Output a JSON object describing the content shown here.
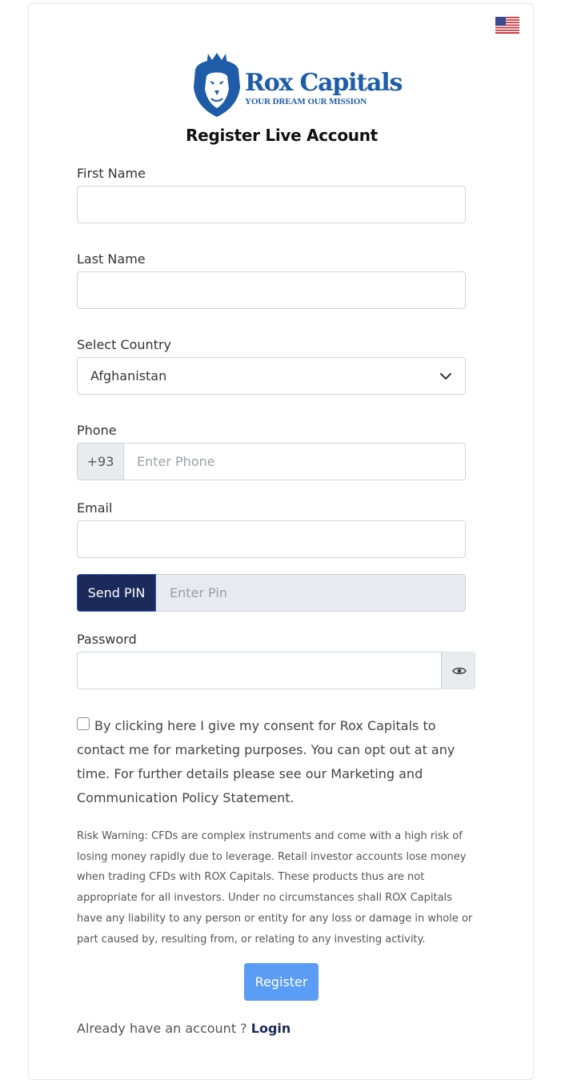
{
  "header": {
    "language_flag": "us-flag-icon",
    "brand_name": "Rox Capitals",
    "brand_tagline": "YOUR DREAM OUR MISSION",
    "title": "Register Live Account"
  },
  "form": {
    "first_name_label": "First Name",
    "first_name_value": "",
    "last_name_label": "Last Name",
    "last_name_value": "",
    "country_label": "Select Country",
    "country_selected": "Afghanistan",
    "phone_label": "Phone",
    "phone_prefix": "+93",
    "phone_placeholder": "Enter Phone",
    "email_label": "Email",
    "email_value": "",
    "send_pin_label": "Send PIN",
    "pin_placeholder": "Enter Pin",
    "password_label": "Password",
    "password_value": ""
  },
  "consent": {
    "checked": false,
    "text": "By clicking here I give my consent for Rox Capitals to contact me for marketing purposes. You can opt out at any time. For further details please see our Marketing and Communication Policy Statement."
  },
  "risk_warning": "Risk Warning: CFDs are complex instruments and come with a high risk of losing money rapidly due to leverage. Retail investor accounts lose money when trading CFDs with ROX Capitals. These products thus are not appropriate for all investors. Under no circumstances shall ROX Capitals have any liability to any person or entity for any loss or damage in whole or part caused by, resulting from, or relating to any investing activity.",
  "footer": {
    "register_label": "Register",
    "have_account_text": "Already have an account ? ",
    "login_label": "Login"
  },
  "colors": {
    "brand_blue": "#1f5ca8",
    "navy": "#1b2a5a",
    "register_blue": "#5b9df5"
  }
}
